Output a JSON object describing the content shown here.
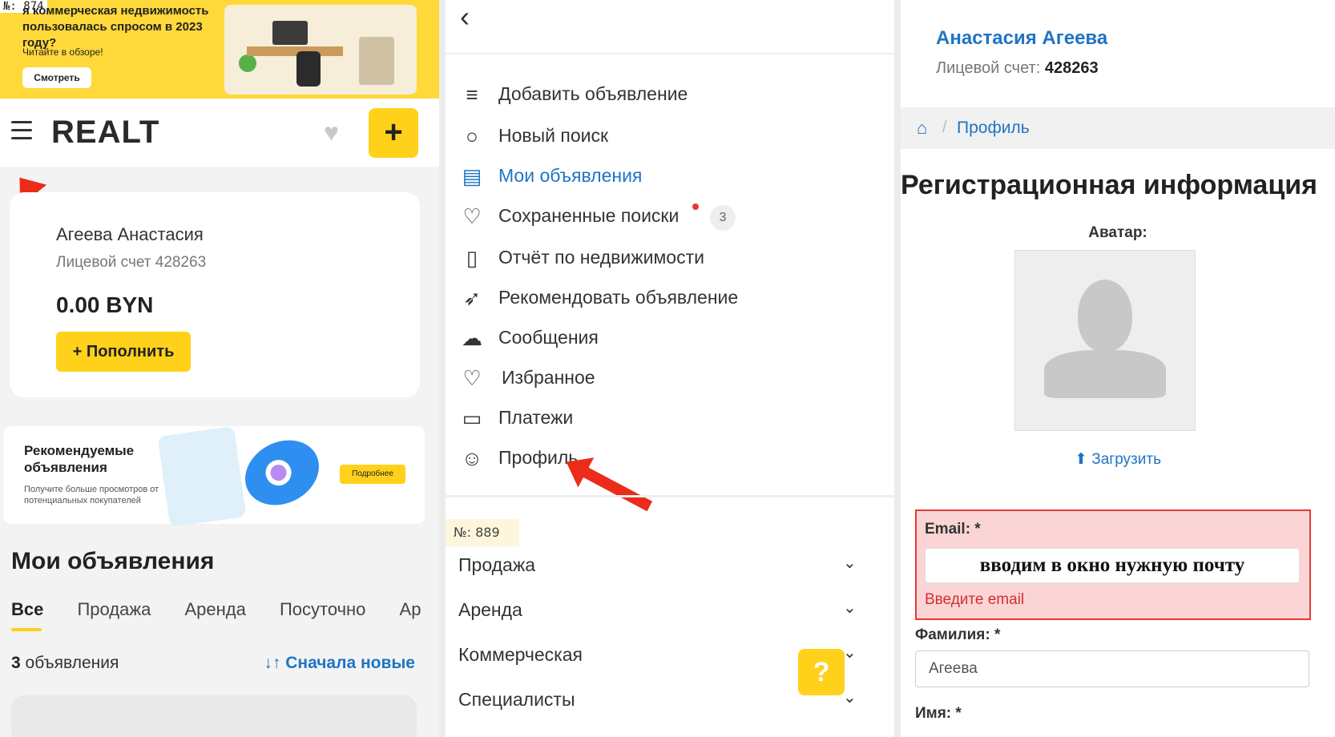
{
  "left_panel": {
    "banner": {
      "number": "№: 874",
      "title": "я коммерческая недвижимость пользовалась спросом в 2023 году?",
      "subtitle": "Читайте в обзоре!",
      "button": "Смотреть"
    },
    "header": {
      "logo": "REALT",
      "add_icon": "+"
    },
    "account": {
      "name": "Агеева Анастасия",
      "account_line": "Лицевой счет 428263",
      "balance": "0.00 BYN",
      "topup_label": "+ Пополнить"
    },
    "promo": {
      "title": "Рекомендуемые объявления",
      "subtitle": "Получите больше просмотров от потенциальных покупателей",
      "button": "Подробнее"
    },
    "my_ads": {
      "title": "Мои объявления",
      "tabs": [
        "Все",
        "Продажа",
        "Аренда",
        "Посуточно",
        "Ар"
      ],
      "count_num": "3",
      "count_text": " объявления",
      "sort_label": "↓↑ Сначала новые"
    }
  },
  "middle_panel": {
    "back_icon": "‹",
    "menu": [
      {
        "label": "Добавить объявление",
        "icon": "add-list-icon"
      },
      {
        "label": "Новый поиск",
        "icon": "search-icon"
      },
      {
        "label": "Мои объявления",
        "icon": "my-ads-icon"
      },
      {
        "label": "Сохраненные поиски",
        "icon": "saved-search-icon"
      },
      {
        "label": "Отчёт по недвижимости",
        "icon": "report-icon"
      },
      {
        "label": "Рекомендовать объявление",
        "icon": "rocket-icon"
      },
      {
        "label": "Сообщения",
        "icon": "chat-icon"
      },
      {
        "label": "Избранное",
        "icon": "heart-icon"
      },
      {
        "label": "Платежи",
        "icon": "wallet-icon"
      },
      {
        "label": "Профиль",
        "icon": "user-icon"
      }
    ],
    "saved_badge": "3",
    "number_tag": "№: 889",
    "sections": [
      "Продажа",
      "Аренда",
      "Коммерческая",
      "Специалисты"
    ],
    "help_label": "?"
  },
  "right_panel": {
    "name": "Анастасия Агеева",
    "account_label": "Лицевой счет: ",
    "account_number": "428263",
    "breadcrumb": "Профиль",
    "heading": "Регистрационная информация",
    "avatar_label": "Аватар:",
    "upload_label": "Загрузить",
    "email_label": "Email: *",
    "email_value": "вводим в окно нужную почту",
    "email_error": "Введите email",
    "lastname_label": "Фамилия: *",
    "lastname_value": "Агеева",
    "firstname_label": "Имя: *"
  },
  "colors": {
    "accent_yellow": "#ffd11a",
    "link_blue": "#1f74c4",
    "error_red": "#e53935",
    "annotation_arrow": "#ec2b1b"
  }
}
